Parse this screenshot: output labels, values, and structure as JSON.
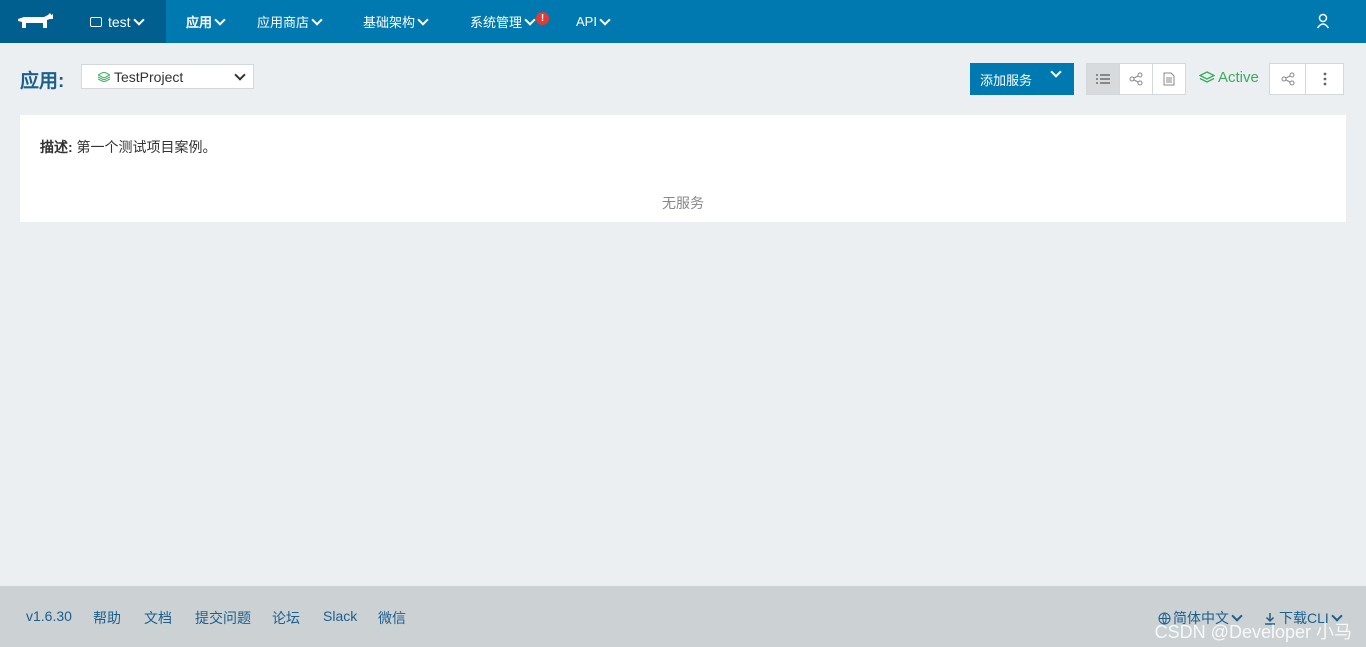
{
  "topnav": {
    "env_label": "test",
    "items": [
      {
        "label": "应用"
      },
      {
        "label": "应用商店"
      },
      {
        "label": "基础架构"
      },
      {
        "label": "系统管理"
      },
      {
        "label": "API"
      }
    ],
    "alert_badge": "!"
  },
  "header": {
    "title": "应用:",
    "project": "TestProject",
    "add_service_label": "添加服务",
    "status": "Active"
  },
  "panel": {
    "desc_label": "描述:",
    "desc_text": " 第一个测试项目案例。",
    "empty_text": "无服务"
  },
  "footer": {
    "links": [
      "v1.6.30",
      "帮助",
      "文档",
      "提交问题",
      "论坛",
      "Slack",
      "微信"
    ],
    "language": "简体中文",
    "download": "下载CLI"
  },
  "watermark": "CSDN @Developer 小马",
  "colors": {
    "nav": "#0079b0",
    "nav_dark": "#005f8f",
    "active": "#3bab5b",
    "title": "#1b5f8d"
  }
}
